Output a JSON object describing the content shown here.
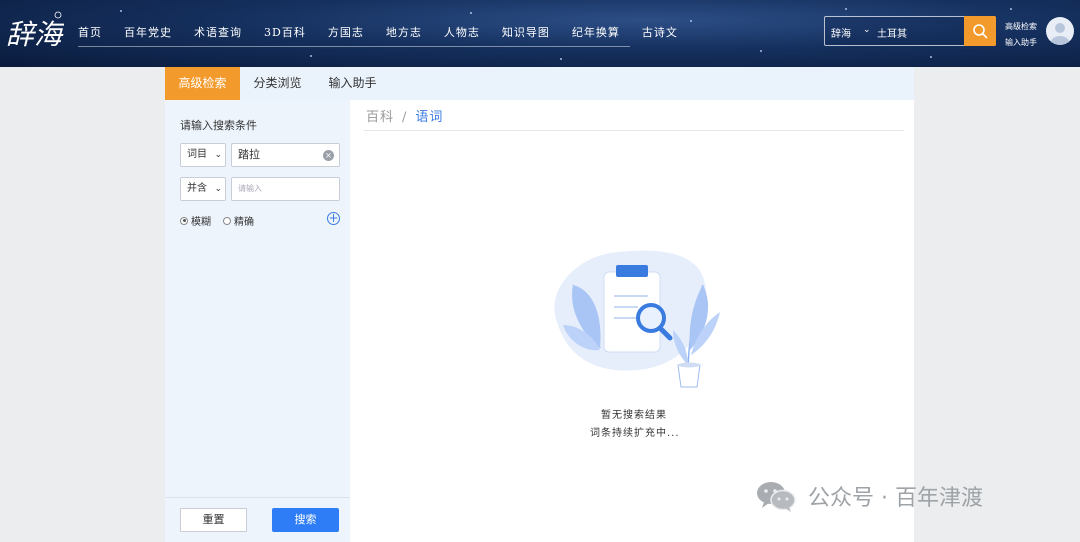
{
  "header": {
    "logo_text": "辞海",
    "nav": [
      "首页",
      "百年党史",
      "术语查询",
      "3D百科",
      "方国志",
      "地方志",
      "人物志",
      "知识导图",
      "纪年换算",
      "古诗文"
    ],
    "search": {
      "scope": "辞海",
      "value": "土耳其"
    },
    "side_links": [
      "高级检索",
      "输入助手"
    ]
  },
  "tabs": [
    "高级检索",
    "分类浏览",
    "输入助手"
  ],
  "sidebar": {
    "title": "请输入搜索条件",
    "row1": {
      "field": "词目",
      "value": "踏拉"
    },
    "row2": {
      "logic": "并含",
      "placeholder": "请输入"
    },
    "match": [
      "模糊",
      "精确"
    ],
    "reset_label": "重置",
    "search_label": "搜索"
  },
  "breadcrumb": [
    "百科",
    "/",
    "语词"
  ],
  "empty": {
    "title": "暂无搜索结果",
    "subtitle": "词条持续扩充中..."
  },
  "watermark": "公众号 · 百年津渡",
  "colors": {
    "accent": "#f39a2c",
    "primary": "#2e7cf6",
    "header": "#15305e"
  }
}
